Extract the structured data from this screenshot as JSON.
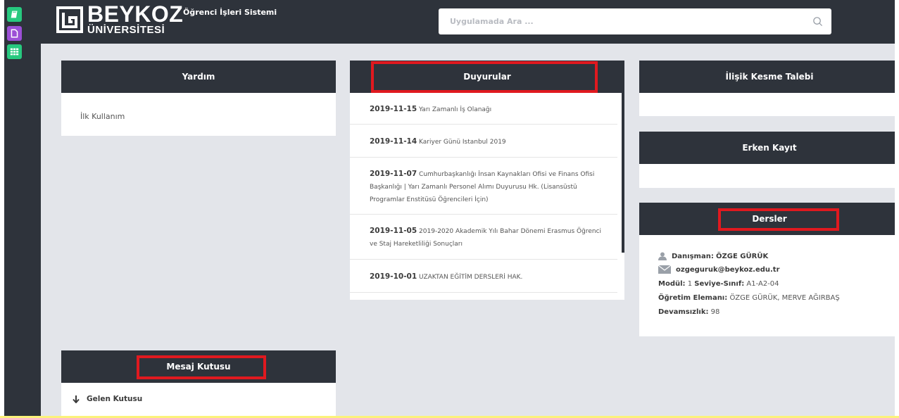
{
  "header": {
    "logo_name": "BEYKOZ",
    "logo_subtitle": "ÜNİVERSİTESİ",
    "system_name": "Öğrenci İşleri Sistemi",
    "search_placeholder": "Uygulamada Ara ..."
  },
  "sidebar": {
    "buttons": [
      {
        "icon": "book-icon",
        "color": "#27c97f"
      },
      {
        "icon": "file-icon",
        "color": "#9c4fd6"
      },
      {
        "icon": "grid-icon",
        "color": "#27c97f"
      }
    ]
  },
  "panels": {
    "yardim": {
      "title": "Yardım",
      "link": "İlk Kullanım"
    },
    "duyurular": {
      "title": "Duyurular",
      "items": [
        {
          "date": "2019-11-15",
          "title": "Yarı Zamanlı İş Olanağı"
        },
        {
          "date": "2019-11-14",
          "title": "Kariyer Günü Istanbul 2019"
        },
        {
          "date": "2019-11-07",
          "title": "Cumhurbaşkanlığı İnsan Kaynakları Ofisi ve Finans Ofisi Başkanlığı | Yarı Zamanlı Personel Alımı Duyurusu Hk. (Lisansüstü Programlar Enstitüsü Öğrencileri İçin)"
        },
        {
          "date": "2019-11-05",
          "title": "2019-2020 Akademik Yılı Bahar Dönemi Erasmus Öğrenci ve Staj Hareketliliği Sonuçları"
        },
        {
          "date": "2019-10-01",
          "title": "UZAKTAN EĞİTİM DERSLERİ HAK."
        }
      ]
    },
    "ilisik": {
      "title": "İlişik Kesme Talebi"
    },
    "erken": {
      "title": "Erken Kayıt"
    },
    "dersler": {
      "title": "Dersler",
      "advisor_label": "Danışman:",
      "advisor_name": "ÖZGE GÜRÜK",
      "email": "ozgeguruk@beykoz.edu.tr",
      "modul_label": "Modül:",
      "modul_value": "1",
      "seviye_label": "Seviye-Sınıf:",
      "seviye_value": "A1-A2-04",
      "ogretim_label": "Öğretim Elemanı:",
      "ogretim_value": "ÖZGE GÜRÜK, MERVE AĞIRBAŞ",
      "devam_label": "Devamsızlık:",
      "devam_value": "98"
    },
    "mesaj": {
      "title": "Mesaj Kutusu",
      "inbox": "Gelen Kutusu"
    }
  },
  "colors": {
    "dark": "#2e333b",
    "background": "#e3e5ea",
    "highlight_red": "#e0191f",
    "green": "#27c97f",
    "purple": "#9c4fd6"
  }
}
